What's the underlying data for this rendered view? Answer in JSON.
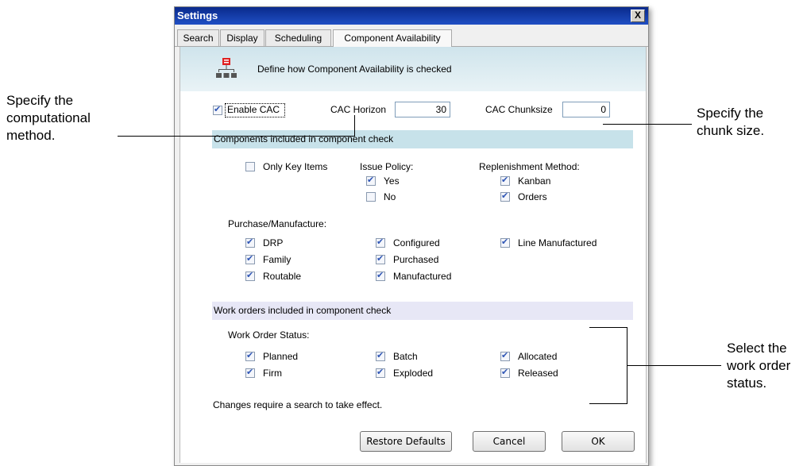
{
  "callouts": {
    "left": [
      "Specify the",
      "computational",
      "method."
    ],
    "chunk": [
      "Specify the",
      "chunk size."
    ],
    "status": [
      "Select the",
      "work order",
      "status."
    ]
  },
  "dialog": {
    "title": "Settings",
    "close_label": "X",
    "tabs": [
      {
        "label": "Search",
        "active": false
      },
      {
        "label": "Display",
        "active": false
      },
      {
        "label": "Scheduling",
        "active": false
      },
      {
        "label": "Component Availability",
        "active": true
      }
    ],
    "header_text": "Define how Component Availability is checked",
    "header_icon": "hierarchy-icon",
    "enable_cac": {
      "label": "Enable CAC",
      "checked": true
    },
    "cac_horizon": {
      "label": "CAC Horizon",
      "value": "30"
    },
    "cac_chunksize": {
      "label": "CAC Chunksize",
      "value": "0"
    },
    "components_section": "Components included in component check",
    "only_key_items": {
      "label": "Only Key Items",
      "checked": false
    },
    "issue_policy": {
      "label": "Issue Policy:",
      "options": [
        {
          "label": "Yes",
          "checked": true
        },
        {
          "label": "No",
          "checked": false
        }
      ]
    },
    "replenishment_method": {
      "label": "Replenishment Method:",
      "options": [
        {
          "label": "Kanban",
          "checked": true
        },
        {
          "label": "Orders",
          "checked": true
        }
      ]
    },
    "purchase_manufacture": {
      "label": "Purchase/Manufacture:",
      "options": [
        {
          "label": "DRP",
          "checked": true
        },
        {
          "label": "Family",
          "checked": true
        },
        {
          "label": "Routable",
          "checked": true
        },
        {
          "label": "Configured",
          "checked": true
        },
        {
          "label": "Purchased",
          "checked": true
        },
        {
          "label": "Manufactured",
          "checked": true
        },
        {
          "label": "Line Manufactured",
          "checked": true
        }
      ]
    },
    "work_orders_section": "Work orders included in component check",
    "work_order_status": {
      "label": "Work Order Status:",
      "options": [
        {
          "label": "Planned",
          "checked": true
        },
        {
          "label": "Firm",
          "checked": true
        },
        {
          "label": "Batch",
          "checked": true
        },
        {
          "label": "Exploded",
          "checked": true
        },
        {
          "label": "Allocated",
          "checked": true
        },
        {
          "label": "Released",
          "checked": true
        }
      ]
    },
    "note": "Changes require a search to take effect.",
    "buttons": {
      "restore": "Restore Defaults",
      "cancel": "Cancel",
      "ok": "OK"
    },
    "colors": {
      "titlebar": "#1f4fc4",
      "section_cyan": "#c7e2ea",
      "section_lavender": "#e7e7f6",
      "check": "#2f56b5"
    }
  }
}
